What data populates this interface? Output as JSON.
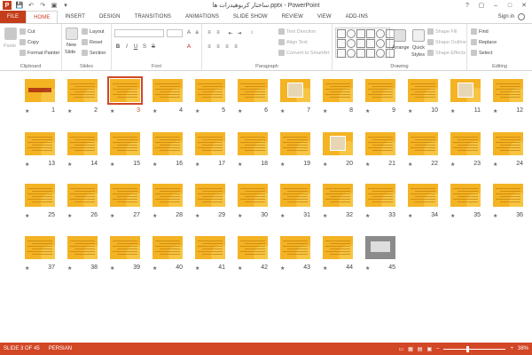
{
  "window": {
    "title": "ساختار کربوهیدرات ها.pptx - PowerPoint",
    "controls": [
      "?",
      "▢",
      "–",
      "□",
      "✕"
    ]
  },
  "qat": [
    "💾",
    "↶",
    "↷",
    "▣",
    "▾"
  ],
  "tabs": [
    {
      "label": "FILE",
      "kind": "file"
    },
    {
      "label": "HOME",
      "kind": "active"
    },
    {
      "label": "INSERT"
    },
    {
      "label": "DESIGN"
    },
    {
      "label": "TRANSITIONS"
    },
    {
      "label": "ANIMATIONS"
    },
    {
      "label": "SLIDE SHOW"
    },
    {
      "label": "REVIEW"
    },
    {
      "label": "VIEW"
    },
    {
      "label": "ADD-INS"
    }
  ],
  "signin": "Sign in",
  "ribbon": {
    "clipboard": {
      "label": "Clipboard",
      "paste": "Paste",
      "cut": "Cut",
      "copy": "Copy",
      "format_painter": "Format Painter"
    },
    "slides": {
      "label": "Slides",
      "new_slide": "New",
      "new_slide2": "Slide",
      "layout": "Layout",
      "reset": "Reset",
      "section": "Section"
    },
    "font": {
      "label": "Font"
    },
    "paragraph": {
      "label": "Paragraph",
      "text_direction": "Text Direction",
      "align_text": "Align Text",
      "convert_smartart": "Convert to SmartArt"
    },
    "drawing": {
      "label": "Drawing",
      "arrange": "Arrange",
      "quick_styles": "Quick",
      "quick_styles2": "Styles",
      "shape_fill": "Shape Fill",
      "shape_outline": "Shape Outline",
      "shape_effects": "Shape Effects"
    },
    "editing": {
      "label": "Editing",
      "find": "Find",
      "replace": "Replace",
      "select": "Select"
    }
  },
  "slides": [
    {
      "n": "12",
      "style": "text"
    },
    {
      "n": "11",
      "style": "pic"
    },
    {
      "n": "10",
      "style": "text"
    },
    {
      "n": "9",
      "style": "text"
    },
    {
      "n": "8",
      "style": "text"
    },
    {
      "n": "7",
      "style": "pic"
    },
    {
      "n": "6",
      "style": "text"
    },
    {
      "n": "5",
      "style": "text"
    },
    {
      "n": "4",
      "style": "text"
    },
    {
      "n": "3",
      "style": "text",
      "selected": true
    },
    {
      "n": "2",
      "style": "text"
    },
    {
      "n": "1",
      "style": "title"
    },
    {
      "n": "24",
      "style": "text"
    },
    {
      "n": "23",
      "style": "text"
    },
    {
      "n": "22",
      "style": "text"
    },
    {
      "n": "21",
      "style": "text"
    },
    {
      "n": "20",
      "style": "pic"
    },
    {
      "n": "19",
      "style": "text"
    },
    {
      "n": "18",
      "style": "text"
    },
    {
      "n": "17",
      "style": "text"
    },
    {
      "n": "16",
      "style": "text"
    },
    {
      "n": "15",
      "style": "text"
    },
    {
      "n": "14",
      "style": "text"
    },
    {
      "n": "13",
      "style": "text"
    },
    {
      "n": "36",
      "style": "text"
    },
    {
      "n": "35",
      "style": "text"
    },
    {
      "n": "34",
      "style": "text"
    },
    {
      "n": "33",
      "style": "text"
    },
    {
      "n": "32",
      "style": "text"
    },
    {
      "n": "31",
      "style": "text"
    },
    {
      "n": "30",
      "style": "text"
    },
    {
      "n": "29",
      "style": "text"
    },
    {
      "n": "28",
      "style": "text"
    },
    {
      "n": "27",
      "style": "text"
    },
    {
      "n": "26",
      "style": "text"
    },
    {
      "n": "25",
      "style": "text"
    },
    {
      "n": "45",
      "style": "photo"
    },
    {
      "n": "44",
      "style": "text"
    },
    {
      "n": "43",
      "style": "text"
    },
    {
      "n": "42",
      "style": "text"
    },
    {
      "n": "41",
      "style": "text"
    },
    {
      "n": "40",
      "style": "text"
    },
    {
      "n": "39",
      "style": "text"
    },
    {
      "n": "38",
      "style": "text"
    },
    {
      "n": "37",
      "style": "text"
    }
  ],
  "status": {
    "slide_of": "SLIDE 3 OF 45",
    "language": "PERSIAN",
    "zoom": "38%",
    "zoom_fraction": 0.38
  },
  "colors": {
    "accent": "#d24726",
    "slide_bg": "#f4b323"
  }
}
